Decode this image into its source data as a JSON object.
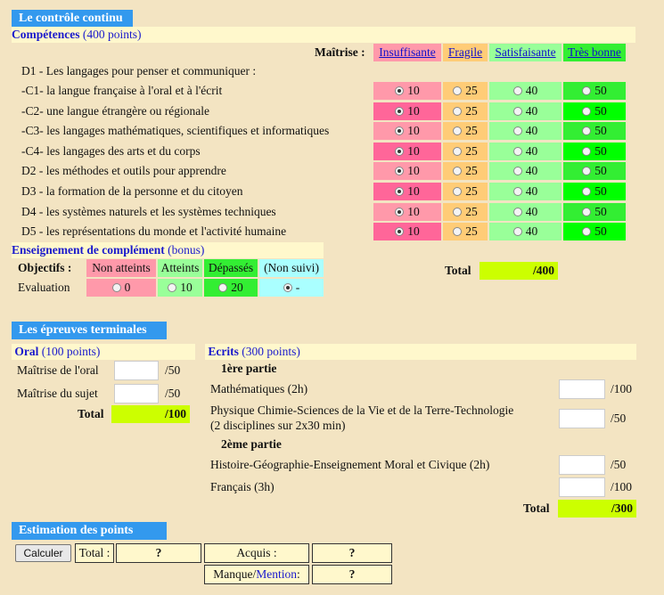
{
  "section1": {
    "title": "Le contrôle continu",
    "competences_label": "Compétences",
    "competences_points": "(400 points)",
    "maitrise_label": "Maîtrise :",
    "levels": [
      "Insuffisante",
      "Fragile",
      "Satisfaisante",
      "Très bonne"
    ],
    "d1_heading": "D1 - Les langages pour penser et communiquer :",
    "rows": [
      {
        "label": "-C1- la langue française à l'oral et à l'écrit",
        "values": [
          "10",
          "25",
          "40",
          "50"
        ],
        "selected": 0
      },
      {
        "label": "-C2- une langue étrangère ou régionale",
        "values": [
          "10",
          "25",
          "40",
          "50"
        ],
        "selected": 0
      },
      {
        "label": "-C3- les langages mathématiques, scientifiques et informatiques",
        "values": [
          "10",
          "25",
          "40",
          "50"
        ],
        "selected": 0
      },
      {
        "label": "-C4- les langages des arts et du corps",
        "values": [
          "10",
          "25",
          "40",
          "50"
        ],
        "selected": 0
      },
      {
        "label": "D2 - les méthodes et outils pour apprendre",
        "values": [
          "10",
          "25",
          "40",
          "50"
        ],
        "selected": 0
      },
      {
        "label": "D3 - la formation de la personne et du citoyen",
        "values": [
          "10",
          "25",
          "40",
          "50"
        ],
        "selected": 0
      },
      {
        "label": "D4 - les systèmes naturels et les systèmes techniques",
        "values": [
          "10",
          "25",
          "40",
          "50"
        ],
        "selected": 0
      },
      {
        "label": "D5 - les représentations du monde et l'activité humaine",
        "values": [
          "10",
          "25",
          "40",
          "50"
        ],
        "selected": 0
      }
    ],
    "complement_label": "Enseignement de complément",
    "complement_bonus": "(bonus)",
    "objectifs_label": "Objectifs :",
    "objectifs": [
      "Non atteints",
      "Atteints",
      "Dépassés",
      "(Non suivi)"
    ],
    "evaluation_label": "Evaluation",
    "evaluation_values": [
      "0",
      "10",
      "20",
      "-"
    ],
    "evaluation_selected": 3,
    "total_label": "Total",
    "total_value": "/400"
  },
  "section2": {
    "title": "Les épreuves terminales",
    "oral_label": "Oral",
    "oral_points": "(100 points)",
    "oral_rows": [
      {
        "label": "Maîtrise de l'oral",
        "max": "/50"
      },
      {
        "label": "Maîtrise du sujet",
        "max": "/50"
      }
    ],
    "oral_total_label": "Total",
    "oral_total_value": "/100",
    "ecrits_label": "Ecrits",
    "ecrits_points": "(300 points)",
    "part1": "1ère partie",
    "part2": "2ème partie",
    "ecrits_rows": [
      {
        "label": "Mathématiques (2h)",
        "max": "/100"
      },
      {
        "label": "Physique Chimie-Sciences de la Vie et de la Terre-Technologie",
        "label2": "(2 disciplines sur 2x30 min)",
        "max": "/50"
      },
      {
        "label": "Histoire-Géographie-Enseignement Moral et Civique (2h)",
        "max": "/50"
      },
      {
        "label": "Français (3h)",
        "max": "/100"
      }
    ],
    "ecrits_total_label": "Total",
    "ecrits_total_value": "/300"
  },
  "section3": {
    "title": "Estimation des points",
    "calc_button": "Calculer",
    "total_label": "Total :",
    "total_value": "?",
    "acquis_label": "Acquis :",
    "acquis_value": "?",
    "manque_label": "Manque/",
    "mention_label": "Mention",
    "manque_suffix": " :",
    "manque_value": "?"
  },
  "colors": {
    "title_bg": "#3399ee",
    "band_bg": "#fff8cc",
    "insuffisante": "#ff99aa",
    "fragile": "#ffcc77",
    "satisfaisante": "#99ff99",
    "tres_bonne": "#33ee33",
    "total_bg": "#ccff00"
  }
}
